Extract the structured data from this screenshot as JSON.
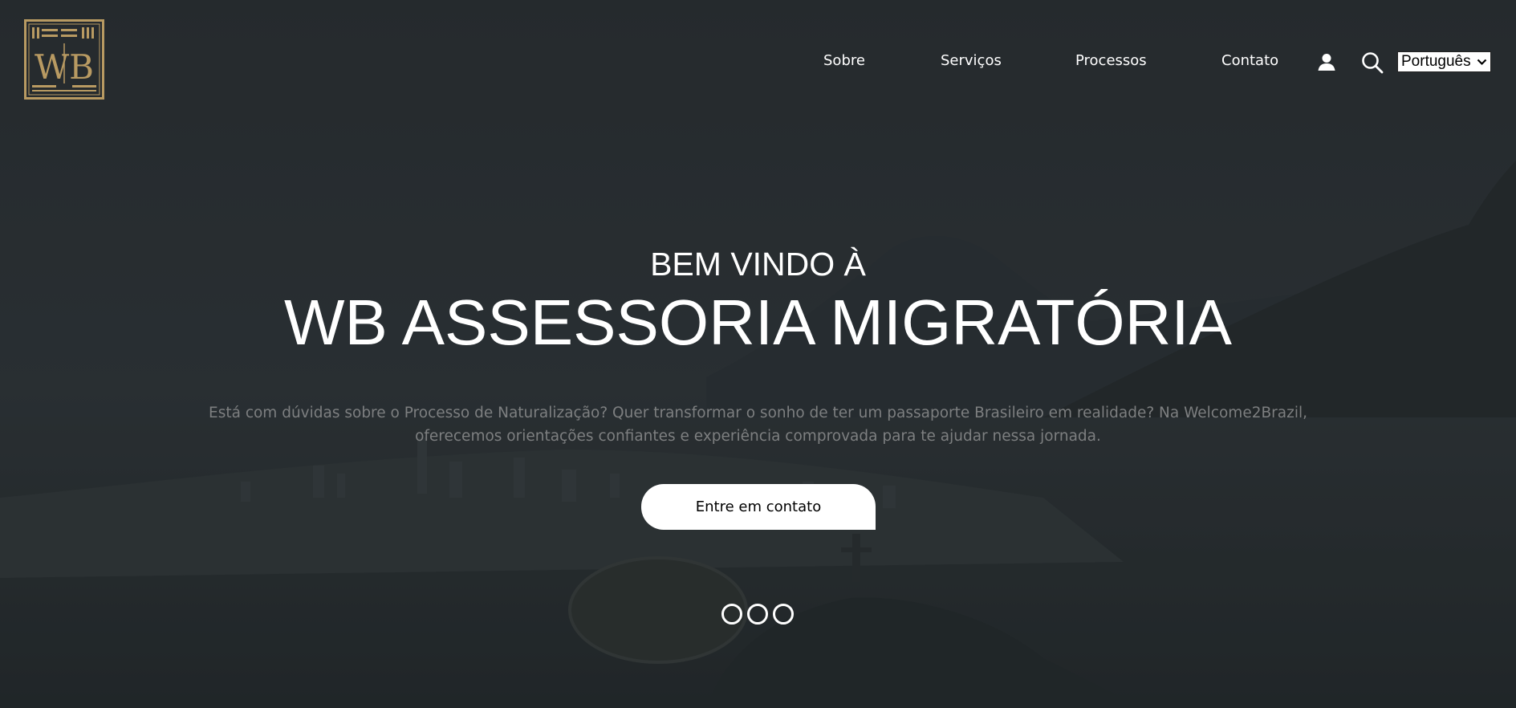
{
  "brand": {
    "logo_text": "WB"
  },
  "nav": {
    "items": [
      {
        "label": "Sobre"
      },
      {
        "label": "Serviços"
      },
      {
        "label": "Processos"
      },
      {
        "label": "Contato"
      }
    ],
    "language": {
      "selected": "Português"
    }
  },
  "icons": {
    "account": "user-icon",
    "search": "search-icon",
    "language_dropdown": "chevron-down-icon"
  },
  "hero": {
    "subtitle": "BEM VINDO À",
    "title": "WB ASSESSORIA MIGRATÓRIA",
    "description": "Está com dúvidas sobre o Processo de Naturalização? Quer transformar o sonho de ter um passaporte Brasileiro em realidade? Na Welcome2Brazil, oferecemos orientações confiantes e experiência comprovada para te ajudar nessa jornada.",
    "cta_label": "Entre em contato"
  },
  "carousel": {
    "slide_count": 3
  },
  "colors": {
    "background": "#2b3033",
    "logo_gold": "#b89a62",
    "text_primary": "#ffffff",
    "text_muted": "#7d7f80",
    "button_bg": "#ffffff"
  }
}
